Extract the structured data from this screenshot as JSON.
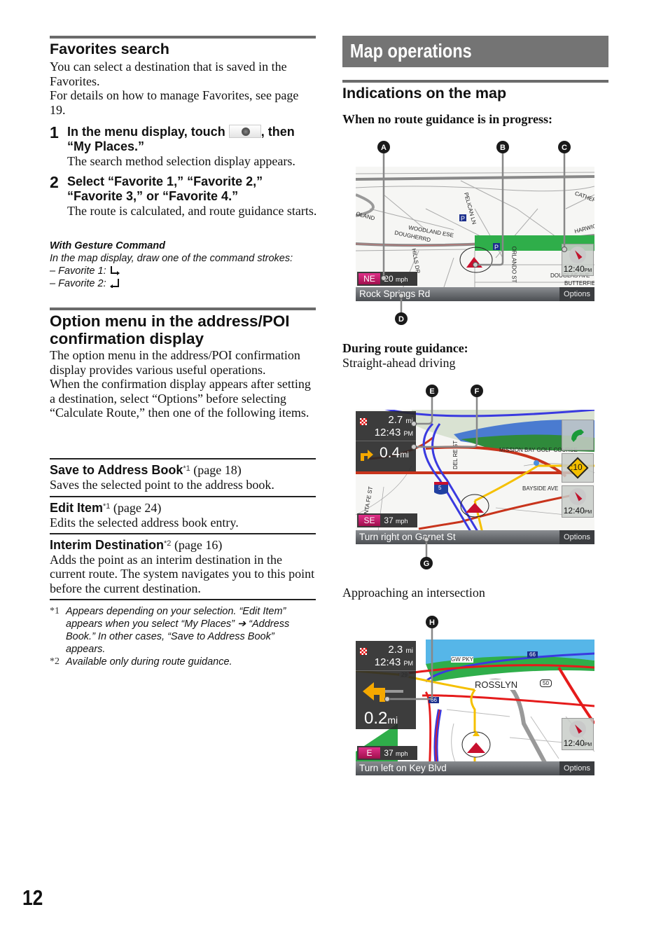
{
  "left": {
    "favorites": {
      "heading": "Favorites search",
      "intro": "You can select a destination that is saved in the Favorites.",
      "intro2": "For details on how to manage Favorites, see page 19.",
      "steps": [
        {
          "num": "1",
          "title_pre": "In the menu display, touch",
          "title_post": ", then “My Places.”",
          "icon": "navigation-menu-icon",
          "desc": "The search method selection display appears."
        },
        {
          "num": "2",
          "title": "Select “Favorite 1,” “Favorite 2,” “Favorite 3,” or “Favorite 4.”",
          "desc": "The route is calculated, and route guidance starts."
        }
      ],
      "gesture": {
        "heading": "With Gesture Command",
        "text": "In the map display, draw one of the command strokes:",
        "items": [
          {
            "label": "– Favorite 1:",
            "stroke": "down-right-stroke-icon"
          },
          {
            "label": "– Favorite 2:",
            "stroke": "down-left-stroke-icon"
          }
        ]
      }
    },
    "option_menu": {
      "heading": "Option menu in the address/POI confirmation display",
      "intro": "The option menu in the address/POI confirmation display provides various useful operations.",
      "intro2": "When the confirmation display appears after setting a destination, select “Options” before selecting “Calculate Route,” then one of the following items.",
      "items": [
        {
          "title": "Save to Address Book",
          "sup": "*1",
          "page": " (page 18)",
          "desc": "Saves the selected point to the address book."
        },
        {
          "title": "Edit Item",
          "sup": "*1",
          "page": " (page 24)",
          "desc": "Edits the selected address book entry."
        },
        {
          "title": "Interim Destination",
          "sup": "*2",
          "page": " (page 16)",
          "desc": "Adds the point as an interim destination in the current route. The system navigates you to this point before the current destination."
        }
      ],
      "footnotes": [
        {
          "mark": "*1",
          "text": "Appears depending on your selection. “Edit Item” appears when you select “My Places” ➔ “Address Book.” In other cases, “Save to Address Book” appears."
        },
        {
          "mark": "*2",
          "text": "Available only during route guidance."
        }
      ]
    }
  },
  "right": {
    "section_title": "Map operations",
    "heading": "Indications on the map",
    "no_route_label": "When no route guidance is in progress:",
    "during_label": "During route guidance:",
    "straight_label": "Straight-ahead driving",
    "approach_label": "Approaching an intersection",
    "map1": {
      "callouts": [
        "A",
        "B",
        "C",
        "D"
      ],
      "heading_dir": "NE",
      "speed": "20",
      "speed_unit": "mph",
      "street": "Rock Springs Rd",
      "options": "Options",
      "clock": "12:40",
      "clock_ampm": "PM",
      "labels": [
        "CATHERIN",
        "HARWIC",
        "WOODLAND ESE",
        "DOUGHERRD",
        "ORLANDO ST",
        "DOUGLAS AVE",
        "BUTTERFIEL",
        "PELICAN LN",
        "OLAND",
        "HILLS DR"
      ]
    },
    "map2": {
      "callouts": [
        "E",
        "F",
        "G"
      ],
      "dest_dist": "2.7",
      "dest_unit": "mi",
      "eta": "12:43",
      "eta_ampm": "PM",
      "turn_dist": "0.4",
      "turn_unit": "mi",
      "heading_dir": "SE",
      "speed": "37",
      "speed_unit": "mph",
      "street": "Turn right on Garnet St",
      "options": "Options",
      "clock": "12:40",
      "clock_ampm": "PM",
      "timer": ":10",
      "interstate": "5",
      "labels": [
        "MISSION BAY GOLF COURSE",
        "DEL RE ST",
        "SANTA FE ST",
        "BAYSIDE AVE"
      ]
    },
    "map3": {
      "callouts": [
        "H"
      ],
      "dest_dist": "2.3",
      "dest_unit": "mi",
      "eta": "12:43",
      "eta_ampm": "PM",
      "turn_dist": "0.2",
      "turn_unit": "mi",
      "heading_dir": "E",
      "speed": "37",
      "speed_unit": "mph",
      "street": "Turn left on Key Blvd",
      "options": "Options",
      "clock": "12:40",
      "clock_ampm": "PM",
      "labels": [
        "ROSSLYN",
        "GW PKY"
      ],
      "shields": [
        "66",
        "66",
        "50",
        "29"
      ]
    },
    "colors": {
      "route": "#f5c000",
      "freeway": "#e51b1b",
      "interstate_blue": "#3a3ae0",
      "green": "#2fae4a",
      "header_bar": "#747474"
    }
  },
  "page_number": "12"
}
